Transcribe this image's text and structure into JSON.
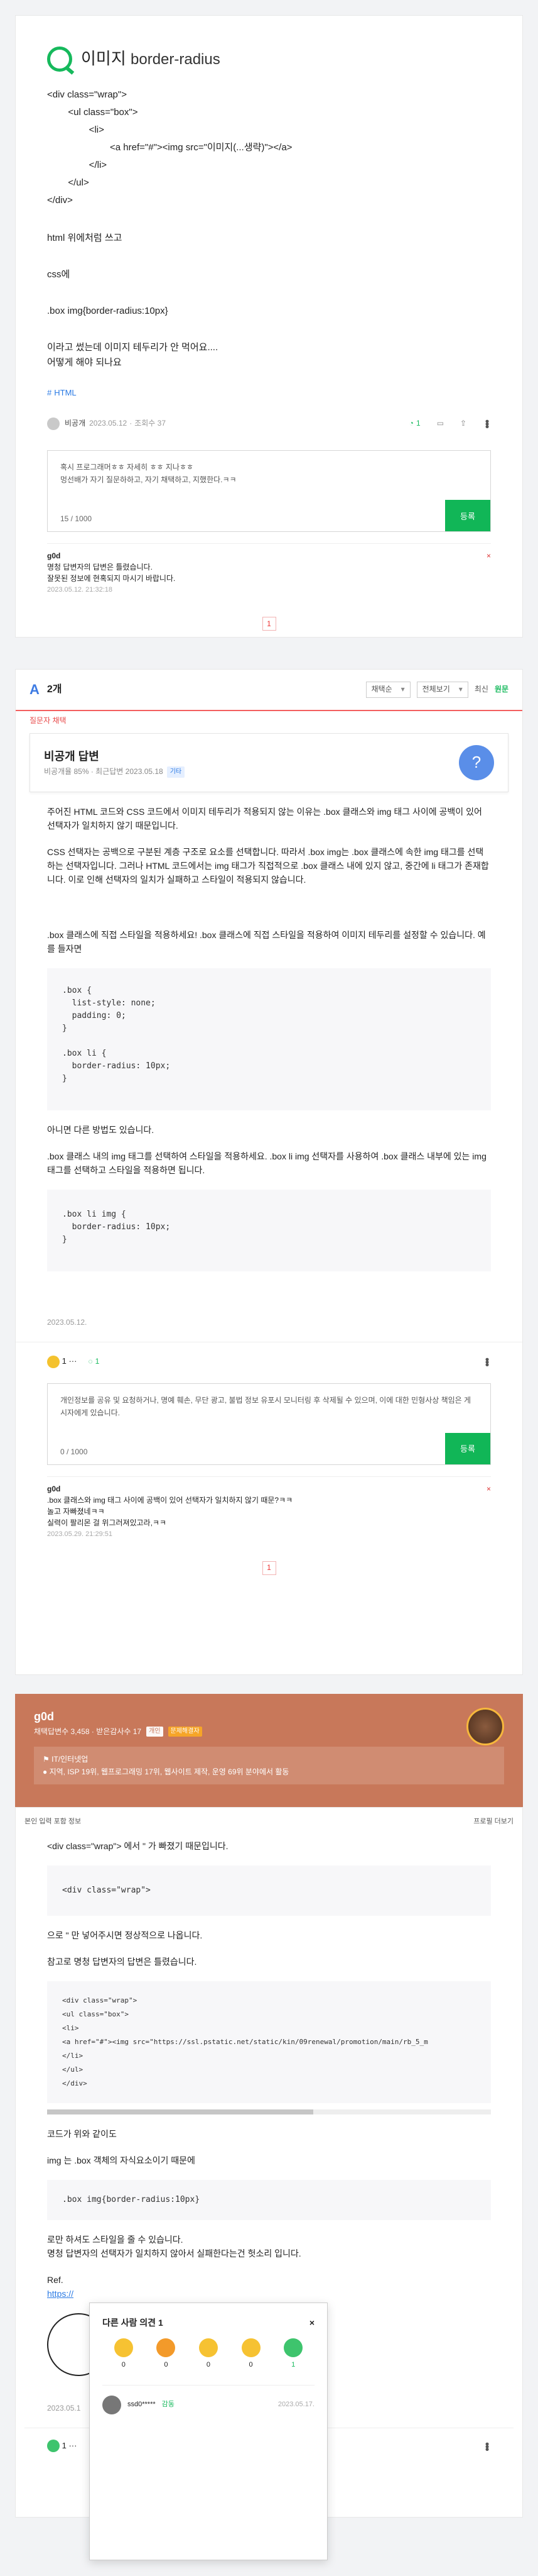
{
  "question": {
    "title_prefix": "이미지",
    "title_suffix": "border-radius",
    "code_lines": [
      "<div class=\"wrap\">",
      "        <ul class=\"box\">",
      "                <li>",
      "                        <a href=\"#\"><img src=\"이미지(...생략)\"></a>",
      "                </li>",
      "        </ul>",
      "</div>"
    ],
    "paragraphs": [
      "html 위에처럼 쓰고",
      "css에",
      ".box img{border-radius:10px}",
      "이라고 썼는데 이미지 테두리가 안 먹어요....",
      "어떻게 해야 되나요"
    ],
    "tag": "HTML",
    "author": "비공개",
    "date": "2023.05.12",
    "views": "조회수 37",
    "like_count": "1",
    "comment_text_1": "혹시 프로그래머ㅎㅎ 자세히 ㅎㅎ 지나ㅎㅎ",
    "comment_text_2": "멍선배가 자기 질문하하고, 자기 채택하고, 지했한다.ㅋㅋ",
    "char_count": "15 / 1000",
    "submit": "등록",
    "comment": {
      "name": "g0d",
      "x": "×",
      "lines": [
        "명청 답변자의 답변은 틀렸습니다.",
        "잘못된 정보에 현혹되지 마시기 바랍니다."
      ],
      "date": "2023.05.12. 21:32:18"
    },
    "page": "1"
  },
  "answers": {
    "count_label": "2개",
    "sort1": "채택순",
    "sort2": "전체보기",
    "sort3": "최신",
    "sort4": "원문",
    "adopted": "질문자 채택",
    "user": {
      "name": "비공개 답변",
      "sub": "비공개율 85% · 최근답변 2023.05.18",
      "badge": "기타",
      "avatar": "?"
    },
    "p1": "주어진 HTML 코드와 CSS 코드에서 이미지 테두리가 적용되지 않는 이유는 .box 클래스와 img 태그 사이에 공백이 있어 선택자가 일치하지 않기 때문입니다.",
    "p2": "CSS 선택자는 공백으로 구분된 계층 구조로 요소를 선택합니다. 따라서 .box img는 .box 클래스에 속한 img 태그를 선택하는 선택자입니다. 그러나 HTML 코드에서는 img 태그가 직접적으로 .box 클래스 내에 있지 않고, 중간에 li 태그가 존재합니다. 이로 인해 선택자의 일치가 실패하고 스타일이 적용되지 않습니다.",
    "p3": ".box 클래스에 직접 스타일을 적용하세요! .box 클래스에 직접 스타일을 적용하여 이미지 테두리를 설정할 수 있습니다. 예를 들자면",
    "code1": ".box {\n  list-style: none;\n  padding: 0;\n}\n\n.box li {\n  border-radius: 10px;\n}",
    "p4": "아니면 다른 방법도 있습니다.",
    "p5": ".box 클래스 내의 img 태그를 선택하여 스타일을 적용하세요. .box li img 선택자를 사용하여 .box 클래스 내부에 있는 img 태그를 선택하고 스타일을 적용하면 됩니다.",
    "code2": ".box li img {\n  border-radius: 10px;\n}",
    "date": "2023.05.12.",
    "like": "1",
    "comment_count": "1",
    "placeholder": "개인정보를 공유 및 요청하거나, 명예 훼손, 무단 광고, 불법 정보 유포시 모니터링 후 삭제될 수 있으며, 이에 대한 민형사상 책임은 게시자에게 있습니다.",
    "char_count": "0 / 1000",
    "submit": "등록",
    "comment": {
      "name": "g0d",
      "x": "×",
      "lines": [
        ".box 클래스와 img 태그 사이에 공백이 있어 선택자가 일치하지 않기 때문?ㅋㅋ",
        "놀고 자빠졌네ㅋㅋ",
        "실력이 팔리몬 걸 위그러져있고라,ㅋㅋ"
      ],
      "date": "2023.05.29. 21:29:51"
    },
    "page": "1"
  },
  "g0d": {
    "name": "g0d",
    "stats": "채택답변수 3,458 · 받은감사수 17",
    "chip1": "개인",
    "chip2": "문제해결자",
    "info1": "IT/인터넷업",
    "info2": "지역, ISP 19위, 웹프로그래밍 17위, 웹사이트 제작, 운영 69위 분야에서 활동",
    "top_left": "본인 입력 포함 정보",
    "top_right": "프로필 더보기",
    "p1": "<div class=\"wrap\"> 에서 \" 가 빠졌기 때문입니다.",
    "code1": "<div class=\"wrap\">",
    "p2": "으로 \" 만 넣어주시면 정상적으로 나옵니다.",
    "p3": "참고로 명청 답변자의 답변은 틀렸습니다.",
    "code2": "<div class=\"wrap\">\n<ul class=\"box\">\n<li>\n<a href=\"#\"><img src=\"https://ssl.pstatic.net/static/kin/09renewal/promotion/main/rb_5_m\n</li>\n</ul>\n</div>",
    "p4": "코드가 위와 같이도",
    "code3": ".box img{border-radius:10px}",
    "p4b": "img 는 .box 객체의 자식요소이기 때문에",
    "p5": "로만 하셔도 스타일을 줄 수 있습니다.",
    "p6": "명청 답변자의 선택자가 일치하지 않아서 실패한다는건 헛소리 입니다.",
    "ref": "Ref.",
    "link": "https://",
    "date": "2023.05.1",
    "like": "1"
  },
  "popup": {
    "title": "다른 사람 의견 1",
    "close": "×",
    "emojis": [
      {
        "n": "0"
      },
      {
        "n": "0"
      },
      {
        "n": "0"
      },
      {
        "n": "0"
      },
      {
        "n": "1"
      }
    ],
    "user": "ssd0*****",
    "user_tag": "감동",
    "date": "2023.05.17."
  }
}
